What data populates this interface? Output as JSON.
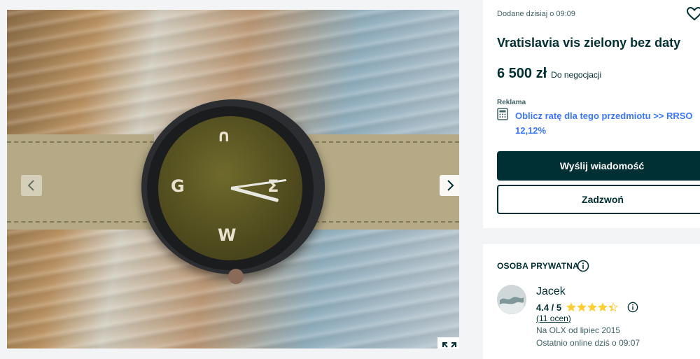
{
  "gallery": {
    "image_alt": "Zegarek Vratislavia zielony",
    "prev_icon": "chevron-left-icon",
    "next_icon": "chevron-right-icon",
    "expand_icon": "expand-icon"
  },
  "listing": {
    "added": "Dodane dzisiaj o 09:09",
    "title": "Vratislavia vis zielony bez daty",
    "price": "6 500 zł",
    "negotiable": "Do negocjacji",
    "ad_label": "Reklama",
    "calc_link": "Oblicz ratę dla tego przedmiotu >> RRSO 12,12%"
  },
  "actions": {
    "message": "Wyślij wiadomość",
    "call": "Zadzwoń"
  },
  "seller": {
    "type": "OSOBA PRYWATNA",
    "name": "Jacek",
    "rating": "4.4 / 5",
    "rating_value": 4.4,
    "reviews": "(11 ocen)",
    "since": "Na OLX od lipiec 2015",
    "last_online": "Ostatnio online dziś o 09:07"
  },
  "colors": {
    "primary": "#002f34",
    "link": "#3a77ff",
    "star": "#ffce32",
    "background": "#f2f4f5"
  }
}
